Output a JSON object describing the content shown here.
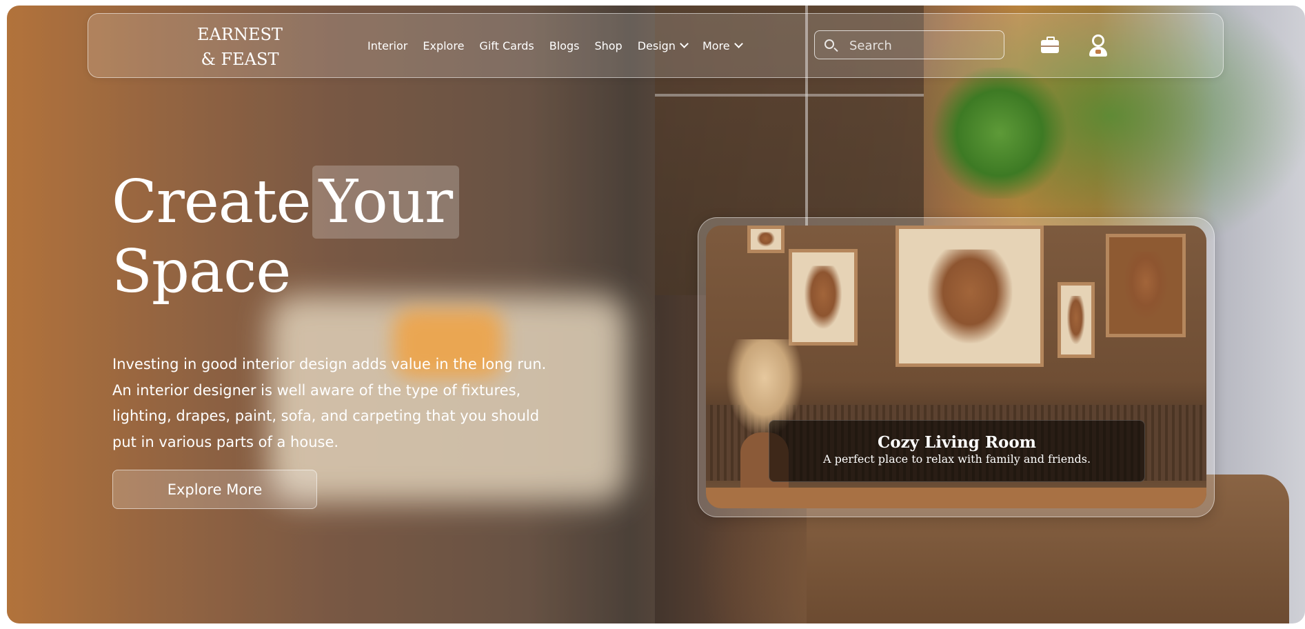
{
  "nav": {
    "logo_line1": "EARNEST",
    "logo_line2": "& FEAST",
    "items": [
      {
        "label": "Interior"
      },
      {
        "label": "Explore"
      },
      {
        "label": "Gift Cards"
      },
      {
        "label": "Blogs"
      },
      {
        "label": "Shop"
      },
      {
        "label": "Design",
        "dropdown": true
      },
      {
        "label": "More",
        "dropdown": true
      }
    ],
    "search_placeholder": "Search",
    "icons": [
      "search-icon",
      "briefcase-icon",
      "user-icon",
      "chevron-down-icon"
    ]
  },
  "hero": {
    "headline_word1": "Create",
    "headline_word2": "Your",
    "headline_word3": "Space",
    "description": "Investing in good interior design adds value in the long run. An interior designer is well aware of the type of fixtures, lighting, drapes, paint, sofa, and carpeting that you should put in various parts of a house.",
    "cta_label": "Explore More"
  },
  "card": {
    "title": "Cozy Living Room",
    "subtitle": "A perfect place to relax with family and friends."
  },
  "colors": {
    "text": "#ffffff",
    "accent_orange": "#f4a23e",
    "caption_bg": "#000000"
  }
}
